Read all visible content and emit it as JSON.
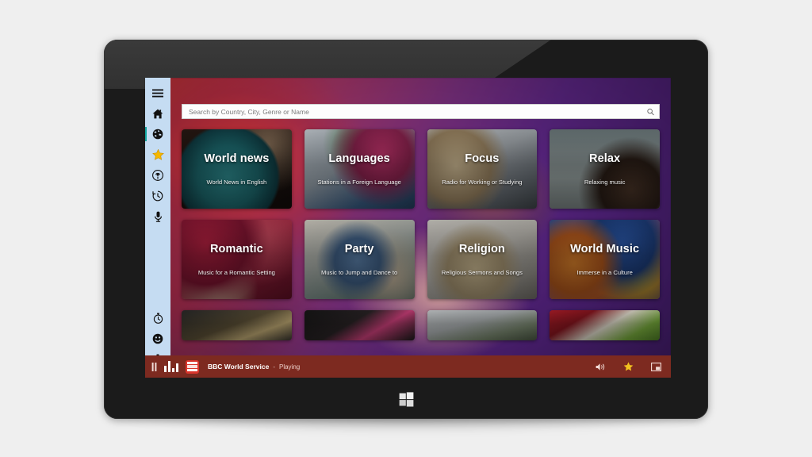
{
  "device": {
    "name": "windows-tablet",
    "os_button": "windows-logo",
    "frame_color": "#1b1b1b"
  },
  "app": {
    "name": "Radio Station App",
    "accent_color": "#7d2a20",
    "rail_color": "#c5dcf2",
    "selection_color": "#12a6a0"
  },
  "sidebar": {
    "items": [
      {
        "id": "menu",
        "icon": "hamburger-menu-icon",
        "selected": false
      },
      {
        "id": "home",
        "icon": "home-icon",
        "selected": false
      },
      {
        "id": "browse",
        "icon": "globe-icon",
        "selected": true
      },
      {
        "id": "favorites",
        "icon": "star-icon",
        "selected": false
      },
      {
        "id": "podcasts",
        "icon": "podcast-icon",
        "selected": false
      },
      {
        "id": "recent",
        "icon": "history-clock-icon",
        "selected": false
      },
      {
        "id": "record",
        "icon": "microphone-icon",
        "selected": false
      }
    ],
    "bottom_items": [
      {
        "id": "sleep-timer",
        "icon": "stopwatch-icon",
        "selected": false
      },
      {
        "id": "account",
        "icon": "smiley-face-icon",
        "selected": false
      },
      {
        "id": "settings",
        "icon": "gear-icon",
        "selected": false
      }
    ]
  },
  "search": {
    "placeholder": "Search by Country, City, Genre or Name",
    "value": "",
    "icon": "search-icon"
  },
  "grid": {
    "tiles": [
      {
        "title": "World news",
        "subtitle": "World News in English",
        "art": "art-globe"
      },
      {
        "title": "Languages",
        "subtitle": "Stations in a Foreign Language",
        "art": "art-languages"
      },
      {
        "title": "Focus",
        "subtitle": "Radio for Working or Studying",
        "art": "art-focus"
      },
      {
        "title": "Relax",
        "subtitle": "Relaxing music",
        "art": "art-relax"
      },
      {
        "title": "Romantic",
        "subtitle": "Music for a Romantic Setting",
        "art": "art-romantic"
      },
      {
        "title": "Party",
        "subtitle": "Music to Jump and Dance to",
        "art": "art-party"
      },
      {
        "title": "Religion",
        "subtitle": "Religious Sermons and Songs",
        "art": "art-religion"
      },
      {
        "title": "World Music",
        "subtitle": "Immerse in a Culture",
        "art": "art-worldmusic"
      }
    ],
    "partial_tiles": [
      {
        "title": "",
        "subtitle": "",
        "art": "art-p1"
      },
      {
        "title": "",
        "subtitle": "",
        "art": "art-p2"
      },
      {
        "title": "",
        "subtitle": "",
        "art": "art-p3"
      },
      {
        "title": "",
        "subtitle": "",
        "art": "art-p4"
      }
    ]
  },
  "player": {
    "play_pause_icon": "pause-icon",
    "equalizer_icon": "equalizer-bars-icon",
    "station_logo": "bbc-logo",
    "station_name": "BBC World Service",
    "separator": "-",
    "status": "Playing",
    "volume_icon": "volume-icon",
    "favorite_icon": "star-icon",
    "pip_icon": "picture-in-picture-icon"
  }
}
